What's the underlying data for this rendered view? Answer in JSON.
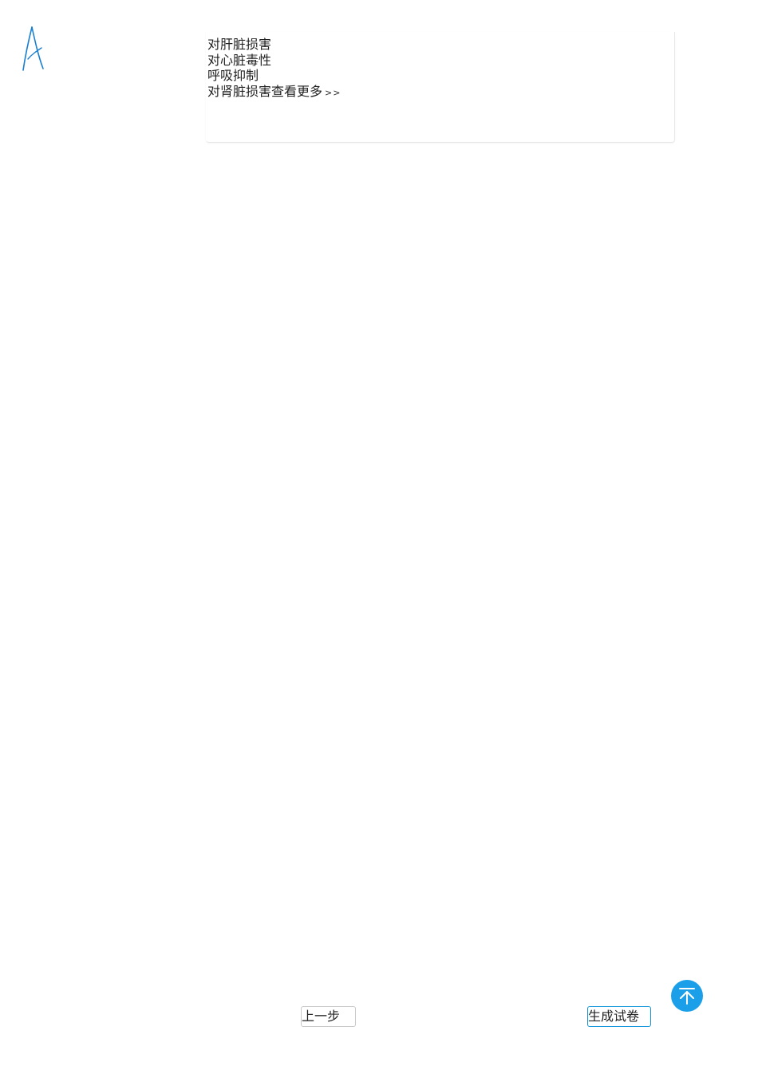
{
  "logo": {
    "icon": "handwritten-A-logo",
    "color": "#1a7fd0"
  },
  "options": {
    "items": [
      "对肝脏损害",
      "对心脏毒性",
      "呼吸抑制",
      "对肾脏损害"
    ],
    "view_more_label": "查看更多",
    "view_more_arrow": ">>"
  },
  "footer": {
    "prev_label": "上一步",
    "generate_label": "生成试卷"
  },
  "back_to_top": {
    "icon": "arrow-up-to-top-icon",
    "color": "#1a9fe8"
  }
}
